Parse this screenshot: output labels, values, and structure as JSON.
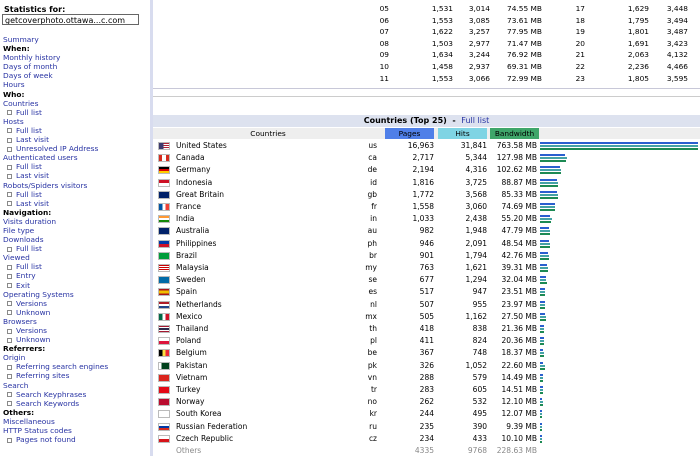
{
  "sidebar": {
    "stats_label": "Statistics for:",
    "site": "getcoverphoto.ottawa...c.com",
    "nav": [
      {
        "text": "Summary",
        "kind": "link"
      },
      {
        "text": "When:",
        "kind": "head"
      },
      {
        "text": "Monthly history",
        "kind": "link"
      },
      {
        "text": "Days of month",
        "kind": "link"
      },
      {
        "text": "Days of week",
        "kind": "link"
      },
      {
        "text": "Hours",
        "kind": "link"
      },
      {
        "text": "Who:",
        "kind": "head"
      },
      {
        "text": "Countries",
        "kind": "link"
      },
      {
        "text": "Full list",
        "kind": "sub"
      },
      {
        "text": "Hosts",
        "kind": "link"
      },
      {
        "text": "Full list",
        "kind": "sub"
      },
      {
        "text": "Last visit",
        "kind": "sub"
      },
      {
        "text": "Unresolved IP Address",
        "kind": "sub"
      },
      {
        "text": "Authenticated users",
        "kind": "link"
      },
      {
        "text": "Full list",
        "kind": "sub"
      },
      {
        "text": "Last visit",
        "kind": "sub"
      },
      {
        "text": "Robots/Spiders visitors",
        "kind": "link"
      },
      {
        "text": "Full list",
        "kind": "sub"
      },
      {
        "text": "Last visit",
        "kind": "sub"
      },
      {
        "text": "Navigation:",
        "kind": "head"
      },
      {
        "text": "Visits duration",
        "kind": "link"
      },
      {
        "text": "File type",
        "kind": "link"
      },
      {
        "text": "Downloads",
        "kind": "link"
      },
      {
        "text": "Full list",
        "kind": "sub"
      },
      {
        "text": "Viewed",
        "kind": "link"
      },
      {
        "text": "Full list",
        "kind": "sub"
      },
      {
        "text": "Entry",
        "kind": "sub"
      },
      {
        "text": "Exit",
        "kind": "sub"
      },
      {
        "text": "Operating Systems",
        "kind": "link"
      },
      {
        "text": "Versions",
        "kind": "sub"
      },
      {
        "text": "Unknown",
        "kind": "sub"
      },
      {
        "text": "Browsers",
        "kind": "link"
      },
      {
        "text": "Versions",
        "kind": "sub"
      },
      {
        "text": "Unknown",
        "kind": "sub"
      },
      {
        "text": "Referrers:",
        "kind": "head"
      },
      {
        "text": "Origin",
        "kind": "link"
      },
      {
        "text": "Referring search engines",
        "kind": "sub"
      },
      {
        "text": "Referring sites",
        "kind": "sub"
      },
      {
        "text": "Search",
        "kind": "link"
      },
      {
        "text": "Search Keyphrases",
        "kind": "sub"
      },
      {
        "text": "Search Keywords",
        "kind": "sub"
      },
      {
        "text": "Others:",
        "kind": "head"
      },
      {
        "text": "Miscellaneous",
        "kind": "link"
      },
      {
        "text": "HTTP Status codes",
        "kind": "link"
      },
      {
        "text": "Pages not found",
        "kind": "sub"
      }
    ]
  },
  "hours_table": [
    {
      "h1": "05",
      "p1": "1,531",
      "hi1": "3,014",
      "b1": "74.55 MB",
      "h2": "17",
      "p2": "1,629",
      "hi2": "3,448"
    },
    {
      "h1": "06",
      "p1": "1,553",
      "hi1": "3,085",
      "b1": "73.61 MB",
      "h2": "18",
      "p2": "1,795",
      "hi2": "3,494"
    },
    {
      "h1": "07",
      "p1": "1,622",
      "hi1": "3,257",
      "b1": "77.95 MB",
      "h2": "19",
      "p2": "1,801",
      "hi2": "3,487"
    },
    {
      "h1": "08",
      "p1": "1,503",
      "hi1": "2,977",
      "b1": "71.47 MB",
      "h2": "20",
      "p2": "1,691",
      "hi2": "3,423"
    },
    {
      "h1": "09",
      "p1": "1,634",
      "hi1": "3,244",
      "b1": "76.92 MB",
      "h2": "21",
      "p2": "2,063",
      "hi2": "4,132"
    },
    {
      "h1": "10",
      "p1": "1,458",
      "hi1": "2,937",
      "b1": "69.31 MB",
      "h2": "22",
      "p2": "2,236",
      "hi2": "4,466"
    },
    {
      "h1": "11",
      "p1": "1,553",
      "hi1": "3,066",
      "b1": "72.99 MB",
      "h2": "23",
      "p2": "1,805",
      "hi2": "3,595"
    }
  ],
  "countries": {
    "title": "Countries (Top 25)",
    "dash": "-",
    "full_list": "Full list",
    "headers": {
      "countries": "Countries",
      "pages": "Pages",
      "hits": "Hits",
      "bandwidth": "Bandwidth"
    },
    "colors": {
      "pages": "#4f7fe8",
      "hits": "#7fd4e4",
      "bandwidth": "#3fa66a"
    },
    "rows": [
      {
        "name": "United States",
        "code": "us",
        "pages": "16,963",
        "hits": "31,841",
        "bw": "763.58 MB",
        "flag": "us",
        "pv": 16963,
        "hv": 31841,
        "bv": 763.58
      },
      {
        "name": "Canada",
        "code": "ca",
        "pages": "2,717",
        "hits": "5,344",
        "bw": "127.98 MB",
        "flag": "ca",
        "pv": 2717,
        "hv": 5344,
        "bv": 127.98
      },
      {
        "name": "Germany",
        "code": "de",
        "pages": "2,194",
        "hits": "4,316",
        "bw": "102.62 MB",
        "flag": "de",
        "pv": 2194,
        "hv": 4316,
        "bv": 102.62
      },
      {
        "name": "Indonesia",
        "code": "id",
        "pages": "1,816",
        "hits": "3,725",
        "bw": "88.87 MB",
        "flag": "id",
        "pv": 1816,
        "hv": 3725,
        "bv": 88.87
      },
      {
        "name": "Great Britain",
        "code": "gb",
        "pages": "1,772",
        "hits": "3,568",
        "bw": "85.33 MB",
        "flag": "gb",
        "pv": 1772,
        "hv": 3568,
        "bv": 85.33
      },
      {
        "name": "France",
        "code": "fr",
        "pages": "1,558",
        "hits": "3,060",
        "bw": "74.69 MB",
        "flag": "fr",
        "pv": 1558,
        "hv": 3060,
        "bv": 74.69
      },
      {
        "name": "India",
        "code": "in",
        "pages": "1,033",
        "hits": "2,438",
        "bw": "55.20 MB",
        "flag": "in",
        "pv": 1033,
        "hv": 2438,
        "bv": 55.2
      },
      {
        "name": "Australia",
        "code": "au",
        "pages": "982",
        "hits": "1,948",
        "bw": "47.79 MB",
        "flag": "au",
        "pv": 982,
        "hv": 1948,
        "bv": 47.79
      },
      {
        "name": "Philippines",
        "code": "ph",
        "pages": "946",
        "hits": "2,091",
        "bw": "48.54 MB",
        "flag": "ph",
        "pv": 946,
        "hv": 2091,
        "bv": 48.54
      },
      {
        "name": "Brazil",
        "code": "br",
        "pages": "901",
        "hits": "1,794",
        "bw": "42.76 MB",
        "flag": "br",
        "pv": 901,
        "hv": 1794,
        "bv": 42.76
      },
      {
        "name": "Malaysia",
        "code": "my",
        "pages": "763",
        "hits": "1,621",
        "bw": "39.31 MB",
        "flag": "my",
        "pv": 763,
        "hv": 1621,
        "bv": 39.31
      },
      {
        "name": "Sweden",
        "code": "se",
        "pages": "677",
        "hits": "1,294",
        "bw": "32.04 MB",
        "flag": "se",
        "pv": 677,
        "hv": 1294,
        "bv": 32.04
      },
      {
        "name": "Spain",
        "code": "es",
        "pages": "517",
        "hits": "947",
        "bw": "23.51 MB",
        "flag": "es",
        "pv": 517,
        "hv": 947,
        "bv": 23.51
      },
      {
        "name": "Netherlands",
        "code": "nl",
        "pages": "507",
        "hits": "955",
        "bw": "23.97 MB",
        "flag": "nl",
        "pv": 507,
        "hv": 955,
        "bv": 23.97
      },
      {
        "name": "Mexico",
        "code": "mx",
        "pages": "505",
        "hits": "1,162",
        "bw": "27.50 MB",
        "flag": "mx",
        "pv": 505,
        "hv": 1162,
        "bv": 27.5
      },
      {
        "name": "Thailand",
        "code": "th",
        "pages": "418",
        "hits": "838",
        "bw": "21.36 MB",
        "flag": "th",
        "pv": 418,
        "hv": 838,
        "bv": 21.36
      },
      {
        "name": "Poland",
        "code": "pl",
        "pages": "411",
        "hits": "824",
        "bw": "20.36 MB",
        "flag": "pl",
        "pv": 411,
        "hv": 824,
        "bv": 20.36
      },
      {
        "name": "Belgium",
        "code": "be",
        "pages": "367",
        "hits": "748",
        "bw": "18.37 MB",
        "flag": "be",
        "pv": 367,
        "hv": 748,
        "bv": 18.37
      },
      {
        "name": "Pakistan",
        "code": "pk",
        "pages": "326",
        "hits": "1,052",
        "bw": "22.60 MB",
        "flag": "pk",
        "pv": 326,
        "hv": 1052,
        "bv": 22.6
      },
      {
        "name": "Vietnam",
        "code": "vn",
        "pages": "288",
        "hits": "579",
        "bw": "14.49 MB",
        "flag": "vn",
        "pv": 288,
        "hv": 579,
        "bv": 14.49
      },
      {
        "name": "Turkey",
        "code": "tr",
        "pages": "283",
        "hits": "605",
        "bw": "14.51 MB",
        "flag": "tr",
        "pv": 283,
        "hv": 605,
        "bv": 14.51
      },
      {
        "name": "Norway",
        "code": "no",
        "pages": "262",
        "hits": "532",
        "bw": "12.10 MB",
        "flag": "no",
        "pv": 262,
        "hv": 532,
        "bv": 12.1
      },
      {
        "name": "South Korea",
        "code": "kr",
        "pages": "244",
        "hits": "495",
        "bw": "12.07 MB",
        "flag": "kr",
        "pv": 244,
        "hv": 495,
        "bv": 12.07
      },
      {
        "name": "Russian Federation",
        "code": "ru",
        "pages": "235",
        "hits": "390",
        "bw": "9.39 MB",
        "flag": "ru",
        "pv": 235,
        "hv": 390,
        "bv": 9.39
      },
      {
        "name": "Czech Republic",
        "code": "cz",
        "pages": "234",
        "hits": "433",
        "bw": "10.10 MB",
        "flag": "cz",
        "pv": 234,
        "hv": 433,
        "bv": 10.1
      }
    ],
    "others": {
      "name": "Others",
      "pages": "4335",
      "hits": "9768",
      "bw": "228.63 MB"
    }
  }
}
